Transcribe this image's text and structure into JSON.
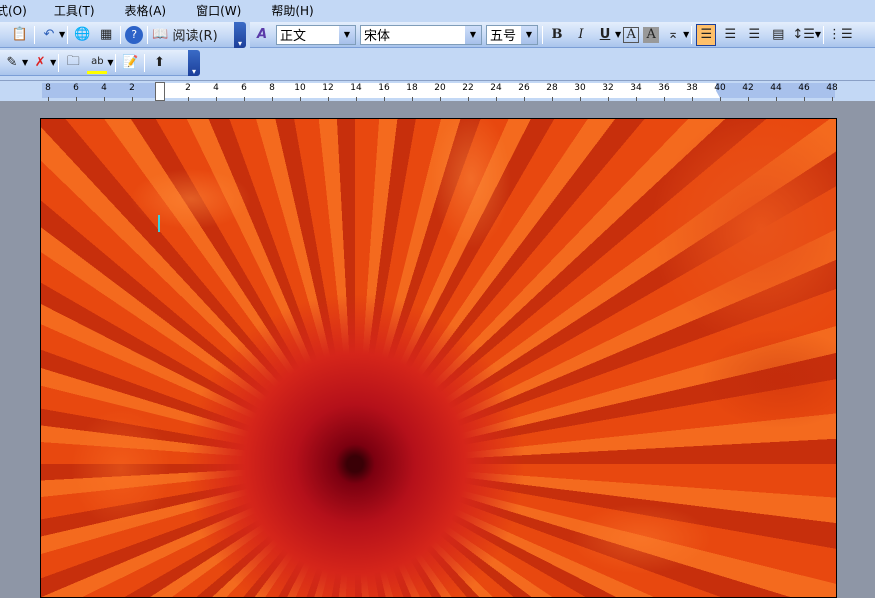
{
  "menu": [
    "式(O)",
    "工具(T)",
    "表格(A)",
    "窗口(W)",
    "帮助(H)"
  ],
  "toolbar1": {
    "read_label": "阅读(R)"
  },
  "format": {
    "style": "正文",
    "font": "宋体",
    "size": "五号",
    "bold": "B",
    "italic": "I",
    "underline": "U",
    "border_char": "A",
    "shade_char": "A"
  },
  "ruler": {
    "labels": [
      8,
      6,
      4,
      2,
      2,
      4,
      6,
      8,
      10,
      12,
      14,
      16,
      18,
      20,
      22,
      24,
      26,
      28,
      30,
      32,
      34,
      36,
      38,
      40,
      42,
      44,
      46,
      48
    ],
    "values": [
      -8,
      -6,
      -4,
      -2,
      2,
      4,
      6,
      8,
      10,
      12,
      14,
      16,
      18,
      20,
      22,
      24,
      26,
      28,
      30,
      32,
      34,
      36,
      38,
      40,
      42,
      44,
      46,
      48
    ]
  },
  "colors": {
    "toolbar_bg": "#c3d8f5",
    "workspace": "#8e96a6",
    "active_button": "#ffc06a"
  }
}
